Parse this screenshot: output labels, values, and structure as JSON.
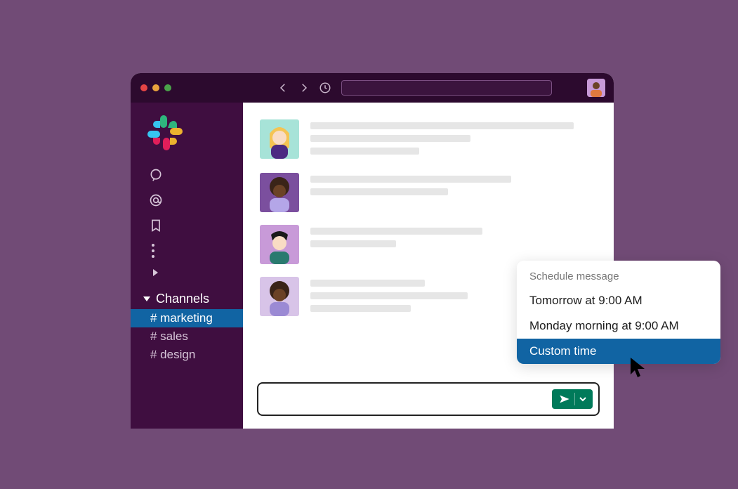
{
  "sidebar": {
    "section_label": "Channels",
    "channels": [
      {
        "name": "# marketing",
        "active": true
      },
      {
        "name": "# sales",
        "active": false
      },
      {
        "name": "# design",
        "active": false
      }
    ]
  },
  "schedule_popup": {
    "title": "Schedule message",
    "options": [
      {
        "label": "Tomorrow at 9:00 AM",
        "highlighted": false
      },
      {
        "label": "Monday morning at 9:00 AM",
        "highlighted": false
      },
      {
        "label": "Custom time",
        "highlighted": true
      }
    ]
  }
}
